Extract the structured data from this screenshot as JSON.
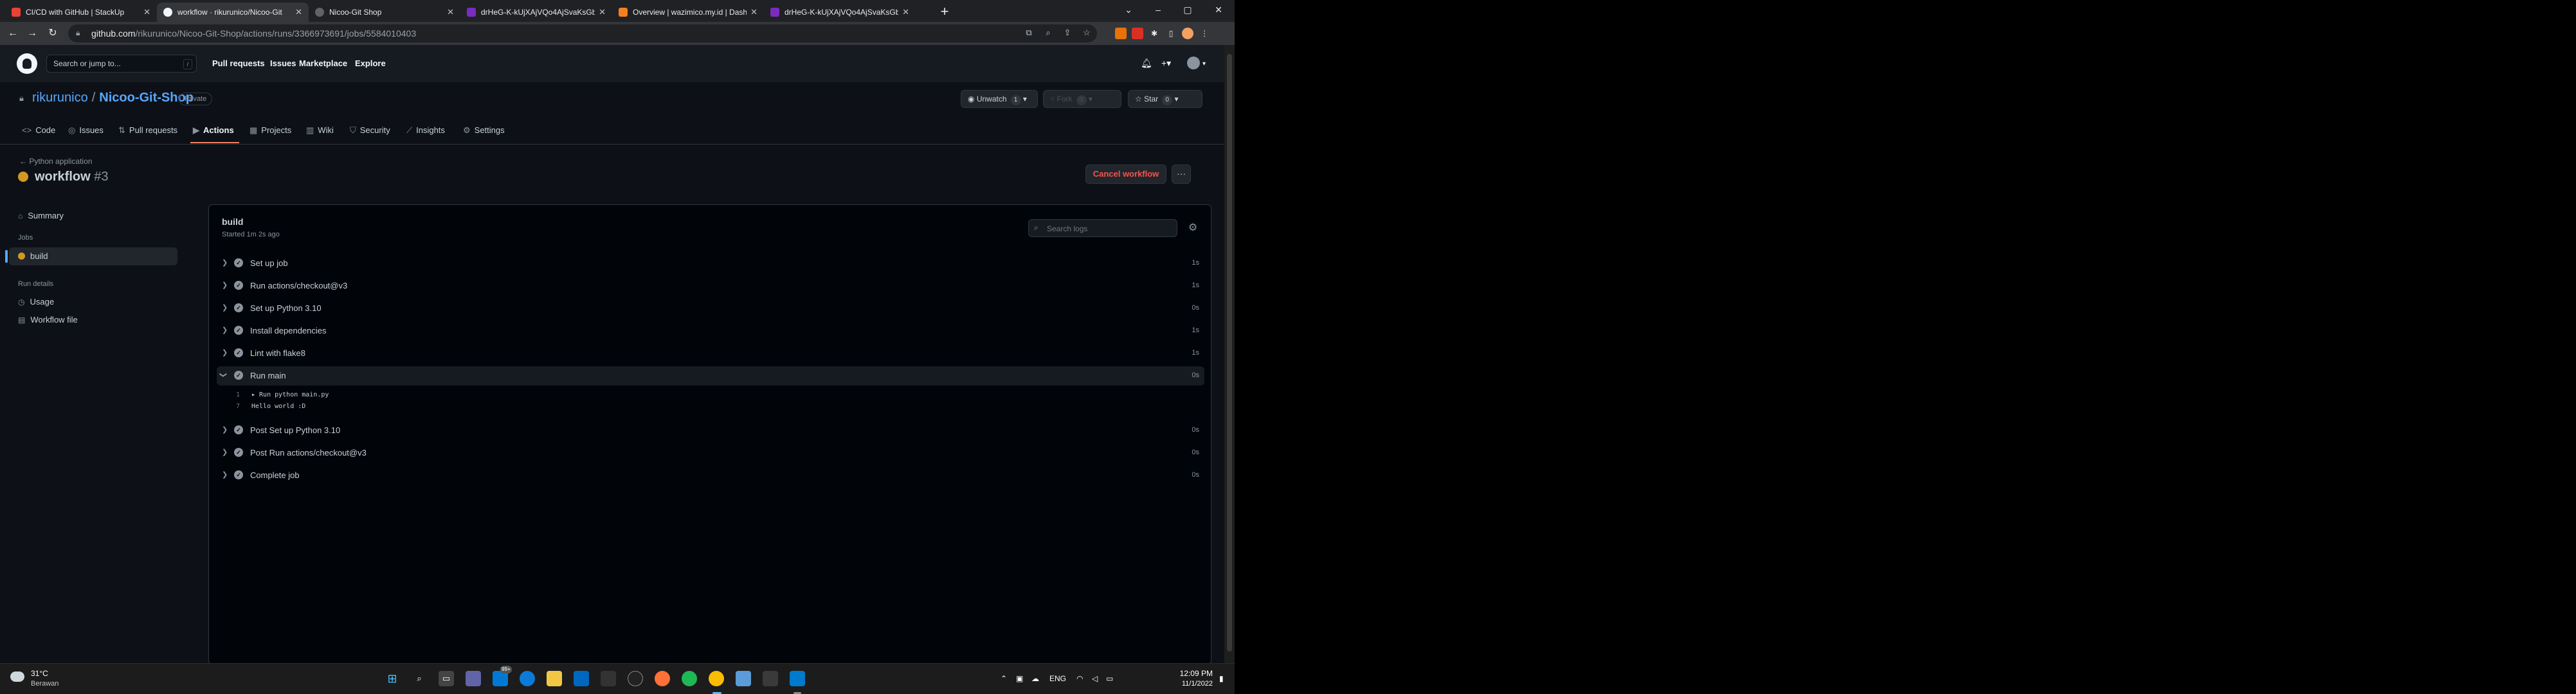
{
  "browser": {
    "tabs": [
      {
        "title": "CI/CD with GitHub | StackUp",
        "favicon_color": "#ea4335"
      },
      {
        "title": "workflow · rikurunico/Nicoo-Git",
        "favicon_color": "#f0f6fc"
      },
      {
        "title": "Nicoo-Git Shop",
        "favicon_color": "#5f6368"
      },
      {
        "title": "drHeG-K-kUjXAjVQo4AjSvaKsGb",
        "favicon_color": "#7b2cbf"
      },
      {
        "title": "Overview | wazimico.my.id | Dash",
        "favicon_color": "#f48120"
      },
      {
        "title": "drHeG-K-kUjXAjVQo4AjSvaKsGb",
        "favicon_color": "#7b2cbf"
      }
    ],
    "url_host": "github.com",
    "url_path": "/rikurunico/Nicoo-Git-Shop/actions/runs/3366973691/jobs/5584010403"
  },
  "github": {
    "search_placeholder": "Search or jump to...",
    "search_shortcut": "/",
    "nav": [
      "Pull requests",
      "Issues",
      "Marketplace",
      "Explore"
    ]
  },
  "repo": {
    "owner": "rikurunico",
    "separator": "/",
    "name": "Nicoo-Git-Shop",
    "visibility": "Private",
    "unwatch_label": "Unwatch",
    "unwatch_count": "1",
    "fork_label": "Fork",
    "fork_count": "0",
    "star_label": "Star",
    "star_count": "0",
    "tabs": [
      "Code",
      "Issues",
      "Pull requests",
      "Actions",
      "Projects",
      "Wiki",
      "Security",
      "Insights",
      "Settings"
    ]
  },
  "workflow": {
    "back_link": "Python application",
    "title": "workflow",
    "run_number": "#3",
    "cancel_label": "Cancel workflow",
    "more_label": "···"
  },
  "sidebar": {
    "summary": "Summary",
    "jobs_header": "Jobs",
    "job": "build",
    "run_details_header": "Run details",
    "usage": "Usage",
    "workflow_file": "Workflow file"
  },
  "job": {
    "name": "build",
    "started": "Started 1m 2s ago",
    "search_placeholder": "Search logs",
    "steps": [
      {
        "label": "Set up job",
        "duration": "1s"
      },
      {
        "label": "Run actions/checkout@v3",
        "duration": "1s"
      },
      {
        "label": "Set up Python 3.10",
        "duration": "0s"
      },
      {
        "label": "Install dependencies",
        "duration": "1s"
      },
      {
        "label": "Lint with flake8",
        "duration": "1s"
      },
      {
        "label": "Run main",
        "duration": "0s"
      },
      {
        "label": "Post Set up Python 3.10",
        "duration": "0s"
      },
      {
        "label": "Post Run actions/checkout@v3",
        "duration": "0s"
      },
      {
        "label": "Complete job",
        "duration": "0s"
      }
    ],
    "log_lines": [
      {
        "num": "1",
        "text": "▸ Run python main.py"
      },
      {
        "num": "7",
        "text": "Hello world :D"
      }
    ]
  },
  "taskbar": {
    "temperature": "31°C",
    "weather": "Berawan",
    "language": "ENG",
    "time": "12:09 PM",
    "date": "11/1/2022",
    "badge": "99+"
  }
}
